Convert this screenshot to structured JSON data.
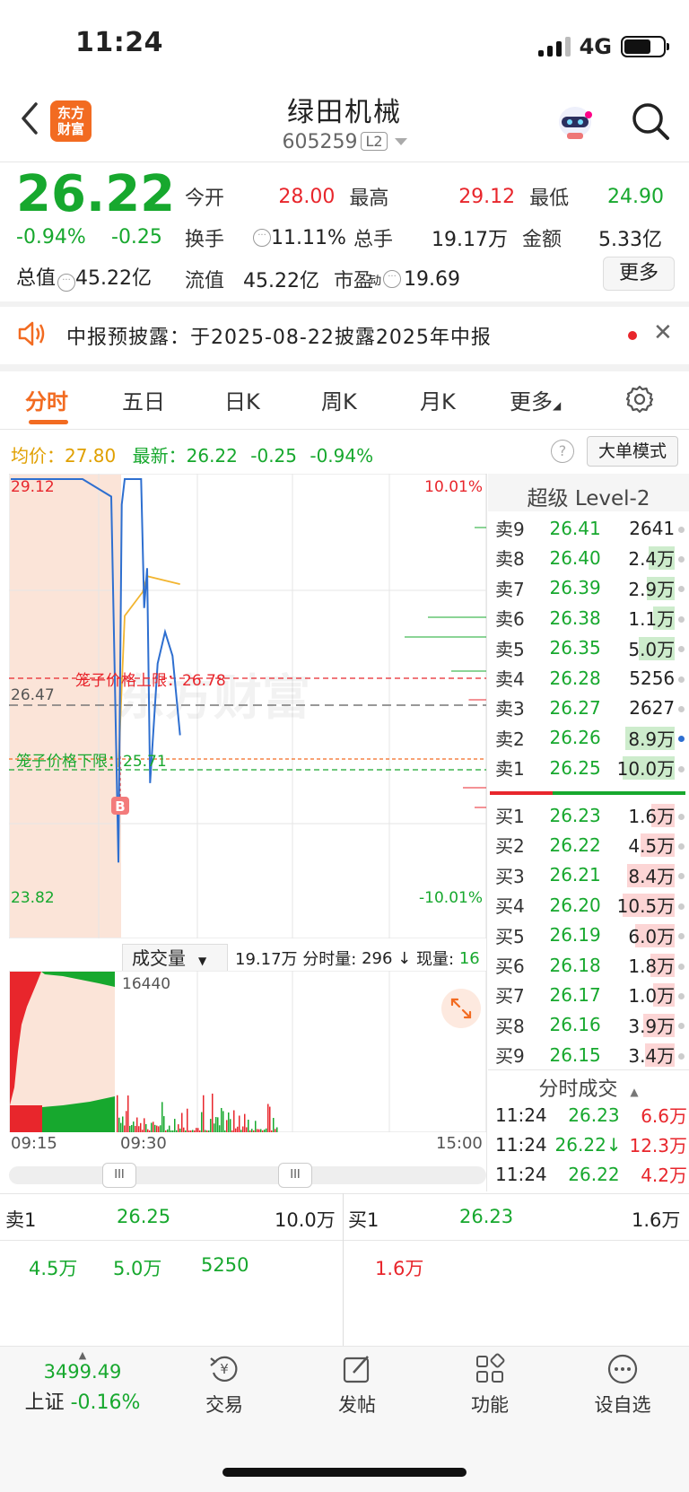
{
  "status": {
    "time": "11:24",
    "network": "4G"
  },
  "header": {
    "logo_line1": "东方",
    "logo_line2": "财富",
    "stock_name": "绿田机械",
    "stock_code": "605259",
    "level_badge": "L2"
  },
  "quote": {
    "price": "26.22",
    "change_pct": "-0.94%",
    "change": "-0.25",
    "market_value_label": "总值",
    "market_value": "45.22亿",
    "fields": [
      {
        "label": "今开",
        "value": "28.00",
        "color": "#e8262c"
      },
      {
        "label": "最高",
        "value": "29.12",
        "color": "#e8262c"
      },
      {
        "label": "最低",
        "value": "24.90",
        "color": "#17a82e"
      },
      {
        "label": "换手",
        "value": "11.11%",
        "color": "#222"
      },
      {
        "label": "总手",
        "value": "19.17万",
        "color": "#222"
      },
      {
        "label": "金额",
        "value": "5.33亿",
        "color": "#222"
      },
      {
        "label": "流值",
        "value": "45.22亿",
        "color": "#222"
      },
      {
        "label": "市盈",
        "value": "19.69",
        "color": "#222"
      }
    ],
    "pe_sup": "动",
    "more_label": "更多"
  },
  "notice": {
    "text": "中报预披露：于2025-08-22披露2025年中报"
  },
  "tabs": [
    "分时",
    "五日",
    "日K",
    "周K",
    "月K",
    "更多"
  ],
  "info": {
    "avg_label": "均价：",
    "avg_value": "27.80",
    "latest_label": "最新：",
    "latest_value": "26.22",
    "latest_change": "-0.25",
    "latest_pct": "-0.94%",
    "big_order_label": "大单模式"
  },
  "chart": {
    "high_label": "29.12",
    "low_label": "23.82",
    "prev_close_label": "26.47",
    "up_limit_pct": "10.01%",
    "down_limit_pct": "-10.01%",
    "cage_upper": "笼子价格上限：26.78",
    "cage_lower": "笼子价格下限：25.71",
    "buy_marker": "B",
    "watermark": "东方财富"
  },
  "chart_data": {
    "type": "line",
    "title": "",
    "x_range": [
      "09:15",
      "15:00"
    ],
    "ylim": [
      23.82,
      29.12
    ],
    "prev_close": 26.47,
    "series": [
      {
        "name": "",
        "x": [
          "09:15",
          "09:25",
          "09:29",
          "09:30",
          "09:31",
          "09:33",
          "09:40",
          "09:44",
          "09:46",
          "09:48",
          "09:50",
          "09:55",
          "10:00",
          "10:05",
          "10:10"
        ],
        "y": [
          29.12,
          29.12,
          28.9,
          24.3,
          28.8,
          29.12,
          29.12,
          29.12,
          27.5,
          28.0,
          25.3,
          26.8,
          27.2,
          26.9,
          25.9
        ]
      },
      {
        "name": "均价",
        "x": [
          "09:30",
          "09:33",
          "09:45",
          "09:48",
          "10:10"
        ],
        "y": [
          25.5,
          27.4,
          27.7,
          27.9,
          27.8
        ]
      }
    ],
    "volume": {
      "max_label": "16440",
      "total": "19.17万",
      "minute_volume": "296",
      "current_volume": "16"
    }
  },
  "volume_header": {
    "select": "成交量",
    "total": "19.17万",
    "minute_label": "分时量:",
    "minute_value": "296",
    "now_label": "现量:",
    "now_value": "16"
  },
  "vol_chart": {
    "max_label": "16440"
  },
  "time_axis": {
    "start": "09:15",
    "open": "09:30",
    "end": "15:00"
  },
  "orderbook": {
    "title": "超级 Level-2",
    "asks": [
      {
        "name": "卖9",
        "price": "26.41",
        "vol": "2641"
      },
      {
        "name": "卖8",
        "price": "26.40",
        "vol": "2.4万"
      },
      {
        "name": "卖7",
        "price": "26.39",
        "vol": "2.9万"
      },
      {
        "name": "卖6",
        "price": "26.38",
        "vol": "1.1万"
      },
      {
        "name": "卖5",
        "price": "26.35",
        "vol": "5.0万"
      },
      {
        "name": "卖4",
        "price": "26.28",
        "vol": "5256"
      },
      {
        "name": "卖3",
        "price": "26.27",
        "vol": "2627"
      },
      {
        "name": "卖2",
        "price": "26.26",
        "vol": "8.9万"
      },
      {
        "name": "卖1",
        "price": "26.25",
        "vol": "10.0万"
      }
    ],
    "bids": [
      {
        "name": "买1",
        "price": "26.23",
        "vol": "1.6万"
      },
      {
        "name": "买2",
        "price": "26.22",
        "vol": "4.5万"
      },
      {
        "name": "买3",
        "price": "26.21",
        "vol": "8.4万"
      },
      {
        "name": "买4",
        "price": "26.20",
        "vol": "10.5万"
      },
      {
        "name": "买5",
        "price": "26.19",
        "vol": "6.0万"
      },
      {
        "name": "买6",
        "price": "26.18",
        "vol": "1.8万"
      },
      {
        "name": "买7",
        "price": "26.17",
        "vol": "1.0万"
      },
      {
        "name": "买8",
        "price": "26.16",
        "vol": "3.9万"
      },
      {
        "name": "买9",
        "price": "26.15",
        "vol": "3.4万"
      }
    ],
    "trades_title": "分时成交",
    "trades": [
      {
        "time": "11:24",
        "price": "26.23",
        "vol": "6.6万"
      },
      {
        "time": "11:24",
        "price": "26.22↓",
        "vol": "12.3万"
      },
      {
        "time": "11:24",
        "price": "26.22",
        "vol": "4.2万"
      }
    ]
  },
  "lower": {
    "ask_label": "卖1",
    "ask_price": "26.25",
    "ask_vol": "10.0万",
    "bid_label": "买1",
    "bid_price": "26.23",
    "bid_vol": "1.6万",
    "ask_queue": [
      "4.5万",
      "5.0万",
      "5250"
    ],
    "bid_queue": [
      "1.6万"
    ]
  },
  "bottom_nav": {
    "index_value": "3499.49",
    "index_name": "上证",
    "index_change": "-0.16%",
    "items": [
      "交易",
      "发帖",
      "功能",
      "设自选"
    ]
  }
}
